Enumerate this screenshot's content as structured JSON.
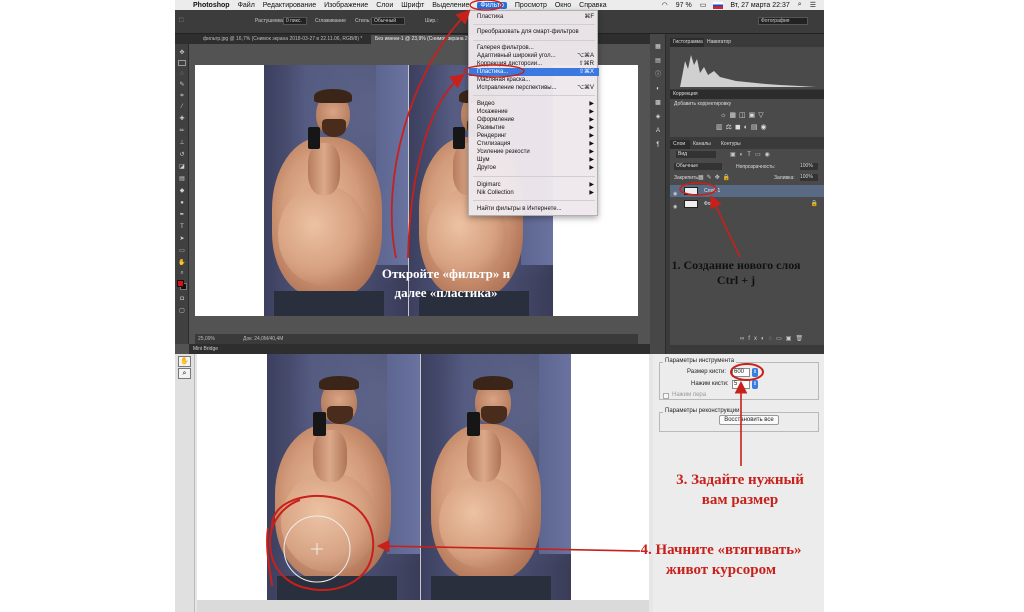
{
  "menubar": {
    "app_name": "Photoshop",
    "items": [
      "Файл",
      "Редактирование",
      "Изображение",
      "Слои",
      "Шрифт",
      "Выделение",
      "Фильтр",
      "Просмотр",
      "Окно",
      "Справка"
    ],
    "active_item": "Фильтр",
    "battery": "97 %",
    "clock": "Вт, 27 марта  22:37"
  },
  "options_bar": {
    "feather_label": "Растушевка:",
    "feather_value": "0 пикс.",
    "antialias_label": "Сглаживание",
    "style_label": "Стиль:",
    "style_value": "Обычный",
    "width_label": "Шир.:",
    "workspace": "Фотография"
  },
  "doc_tabs": [
    {
      "label": "фильтр.jpg @ 16,7% (Снимок экрана 2018-03-27 в 22.11.06, RGB/8) *"
    },
    {
      "label": "Без имени-1 @ 23,9% (Снимок экрана 2018-03-27 в 22.11.06, RGB/8)"
    }
  ],
  "filter_menu": {
    "items": [
      {
        "label": "Пластика",
        "shortcut": "⌘F"
      },
      {
        "label": "Преобразовать для смарт-фильтров",
        "shortcut": ""
      },
      {
        "label": "Галерея фильтров...",
        "shortcut": ""
      },
      {
        "label": "Адаптивный широкий угол...",
        "shortcut": "⌥⌘A"
      },
      {
        "label": "Коррекция дисторсии...",
        "shortcut": "⇧⌘R"
      },
      {
        "label": "Пластика...",
        "shortcut": "⇧⌘X"
      },
      {
        "label": "Масляная краска...",
        "shortcut": ""
      },
      {
        "label": "Исправление перспективы...",
        "shortcut": "⌥⌘V"
      },
      {
        "label": "Видео",
        "shortcut": "▶"
      },
      {
        "label": "Искажение",
        "shortcut": "▶"
      },
      {
        "label": "Оформление",
        "shortcut": "▶"
      },
      {
        "label": "Размытие",
        "shortcut": "▶"
      },
      {
        "label": "Рендеринг",
        "shortcut": "▶"
      },
      {
        "label": "Стилизация",
        "shortcut": "▶"
      },
      {
        "label": "Усиление резкости",
        "shortcut": "▶"
      },
      {
        "label": "Шум",
        "shortcut": "▶"
      },
      {
        "label": "Другое",
        "shortcut": "▶"
      },
      {
        "label": "Digimarc",
        "shortcut": "▶"
      },
      {
        "label": "Nik Collection",
        "shortcut": "▶"
      },
      {
        "label": "Найти фильтры в Интернете...",
        "shortcut": ""
      }
    ],
    "highlighted": "Пластика..."
  },
  "panels": {
    "histogram_tab": "Гистограмма",
    "navigator_tab": "Навигатор",
    "corrections_tab": "Коррекция",
    "corrections_subtitle": "Добавить корректировку",
    "layers_tab": "Слои",
    "channels_tab": "Каналы",
    "paths_tab": "Контуры",
    "kind_filter": "Вид",
    "blend_mode": "Обычные",
    "opacity_label": "Непрозрачность:",
    "opacity_value": "100%",
    "lock_label": "Закрепить:",
    "fill_label": "Заливка:",
    "fill_value": "100%",
    "layers": [
      {
        "name": "Слой 1"
      },
      {
        "name": "Фон"
      }
    ]
  },
  "status": {
    "zoom": "25,09%",
    "doc_size": "Док: 24,0M/40,4M",
    "mini_bridge": "Mini Bridge"
  },
  "liquify_panel": {
    "tool_options_title": "Параметры инструмента",
    "brush_size_label": "Размер кисти:",
    "brush_size_value": "600",
    "brush_pressure_label": "Нажим кисти:",
    "brush_pressure_value": "5",
    "stylus_label": "Нажим пера",
    "reconstruct_title": "Параметры реконструкции",
    "restore_all_button": "Восстановить все"
  },
  "annotations": {
    "open_filter": "Откройте «фильтр» и",
    "then_liquify": "далее «пластика»",
    "new_layer_1": "1. Создание нового слоя",
    "new_layer_2": "Ctrl + j",
    "set_size_1": "3. Задайте нужный",
    "set_size_2": "вам размер",
    "pull_belly_1": "4. Начните «втягивать»",
    "pull_belly_2": "живот курсором"
  },
  "colors": {
    "annotation_red": "#c8201a",
    "menu_highlight": "#3b78e0",
    "ps_dark": "#535353"
  }
}
